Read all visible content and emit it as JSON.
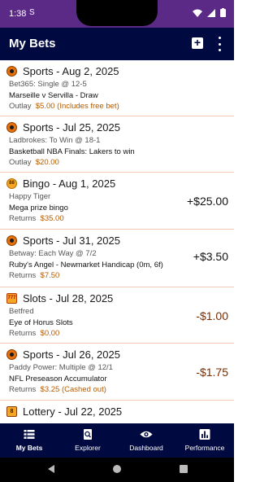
{
  "status_bar": {
    "time": "1:38",
    "app_icon": "S"
  },
  "app_bar": {
    "title": "My Bets",
    "add_icon": "plus-box-icon",
    "more_icon": "more-vert-icon"
  },
  "bets": [
    {
      "type": "sports",
      "icon_text": "",
      "title": "Sports - Aug 2, 2025",
      "line1": "Bet365: Single @ 12-5",
      "line2": "Marseille v Servilla - Draw",
      "info_label": "Outlay",
      "info_value": "$5.00 (Includes free bet)",
      "amount": ""
    },
    {
      "type": "sports",
      "icon_text": "",
      "title": "Sports - Jul 25, 2025",
      "line1": "Ladbrokes: To Win @ 18-1",
      "line2": "Basketball NBA Finals: Lakers to win",
      "info_label": "Outlay",
      "info_value": "$20.00",
      "amount": ""
    },
    {
      "type": "bingo",
      "icon_text": "88",
      "title": "Bingo - Aug 1, 2025",
      "line1": "Happy Tiger",
      "line2": "Mega prize bingo",
      "info_label": "Returns",
      "info_value": "$35.00",
      "amount": "+$25.00"
    },
    {
      "type": "sports",
      "icon_text": "",
      "title": "Sports - Jul 31, 2025",
      "line1": "Betway: Each Way @ 7/2",
      "line2": "Ruby's Angel - Newmarket Handicap (0m, 6f)",
      "info_label": "Returns",
      "info_value": "$7.50",
      "amount": "+$3.50"
    },
    {
      "type": "slots",
      "icon_text": "777",
      "title": "Slots - Jul 28, 2025",
      "line1": "Betfred",
      "line2": "Eye of Horus Slots",
      "info_label": "Returns",
      "info_value": "$0.00",
      "amount": "-$1.00"
    },
    {
      "type": "sports",
      "icon_text": "",
      "title": "Sports - Jul 26, 2025",
      "line1": "Paddy Power: Multiple @ 12/1",
      "line2": "NFL Preseason Accumulator",
      "info_label": "Returns",
      "info_value": "$3.25 (Cashed out)",
      "amount": "-$1.75"
    },
    {
      "type": "lottery",
      "icon_text": "8",
      "title": "Lottery - Jul 22, 2025",
      "line1": "",
      "line2": "",
      "info_label": "",
      "info_value": "",
      "amount": ""
    }
  ],
  "bottom_nav": [
    {
      "label": "My Bets",
      "icon": "list-icon",
      "active": true
    },
    {
      "label": "Explorer",
      "icon": "search-doc-icon",
      "active": false
    },
    {
      "label": "Dashboard",
      "icon": "eye-icon",
      "active": false
    },
    {
      "label": "Performance",
      "icon": "chart-icon",
      "active": false
    }
  ],
  "colors": {
    "status_bar": "#5b2a86",
    "app_bar": "#000a40",
    "value_text": "#b35b00",
    "negative_amount": "#7a2d00",
    "divider": "#f0c9b6"
  }
}
